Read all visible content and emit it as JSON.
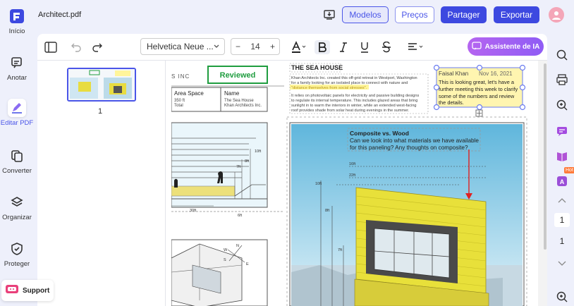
{
  "left_rail": {
    "items": [
      {
        "label": "Início",
        "icon": "home-icon"
      },
      {
        "label": "Anotar",
        "icon": "annotate-icon"
      },
      {
        "label": "Editar PDF",
        "icon": "edit-pdf-icon"
      },
      {
        "label": "Converter",
        "icon": "convert-icon"
      },
      {
        "label": "Organizar",
        "icon": "layers-icon"
      },
      {
        "label": "Proteger",
        "icon": "shield-icon"
      }
    ],
    "support_label": "Support"
  },
  "topbar": {
    "file_title": "Architect.pdf",
    "modelos": "Modelos",
    "precos": "Preços",
    "partager": "Partager",
    "exportar": "Exportar"
  },
  "toolbar": {
    "font_name": "Helvetica Neue ...",
    "font_size": "14",
    "ai_button": "Assistente de IA"
  },
  "thumbnails": {
    "page_number": "1"
  },
  "document": {
    "header_left": "S INC",
    "stamp": "Reviewed",
    "table_area_space": "Area Space",
    "table_area_value": "350 ft",
    "table_total": "Total",
    "table_name": "Name",
    "table_name_value": "The Sea House",
    "table_company": "Khan Architects Inc.",
    "heading": "THE SEA HOUSE",
    "para1_a": "Khan Architects Inc. created this off-grid retreat in Westport, Washington",
    "para1_b": "for a family looking for an isolated place to connect with nature and",
    "para1_highlight": "\"distance themselves from social stresses\".",
    "para2": [
      "It relies on photovoltaic panels for electricity and passive building designs",
      "to regulate its internal temperature. This includes glazed areas that bring",
      "sunlight in to warm the interiors in winter, while an extended west-facing",
      "roof provides shade from solar heat during evenings in the summer."
    ],
    "comment_author": "Faisal Khan",
    "comment_date": "Nov 16, 2021",
    "comment_lines": [
      "This is looking great, let's have a",
      "further meeting this week to clarify",
      "some of the numbers and review",
      "the details."
    ],
    "composite_title": "Composite vs. Wood",
    "composite_lines": [
      "Can we look into what materials we have available",
      "for this paneling? Any thoughts on composite?"
    ],
    "dims": [
      "10ft",
      "8ft",
      "7ft",
      "30ft",
      "6ft",
      "16ft",
      "22ft",
      "10ft",
      "8ft",
      "7ft"
    ],
    "compass": [
      "W",
      "N",
      "S",
      "E"
    ]
  },
  "right_rail": {
    "hot_badge": "Hot",
    "page_current": "1",
    "page_total": "1"
  },
  "colors": {
    "accent": "#3d49e0",
    "stamp_green": "#1f9d3f",
    "ai_purple": "#9b5cf5",
    "highlight_yellow": "#fff59a",
    "arrow_red": "#e02020"
  }
}
